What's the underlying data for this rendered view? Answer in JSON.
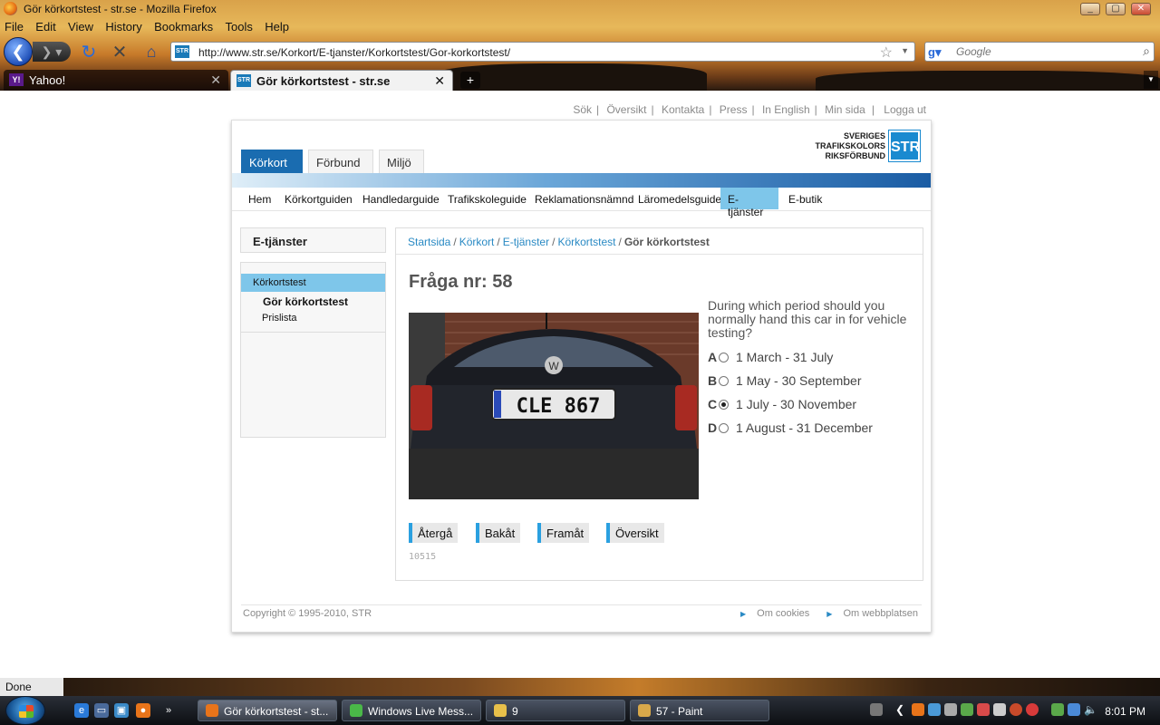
{
  "window": {
    "title": "Gör körkortstest - str.se - Mozilla Firefox"
  },
  "menu": [
    "File",
    "Edit",
    "View",
    "History",
    "Bookmarks",
    "Tools",
    "Help"
  ],
  "toolbar": {
    "url": "http://www.str.se/Korkort/E-tjanster/Korkortstest/Gor-korkortstest/",
    "search_placeholder": "Google"
  },
  "tabs": [
    {
      "label": "Yahoo!",
      "active": false
    },
    {
      "label": "Gör körkortstest - str.se",
      "active": true
    }
  ],
  "site": {
    "topnav": [
      "Sök",
      "Översikt",
      "Kontakta",
      "Press",
      "In English",
      "Min sida",
      "Logga ut"
    ],
    "logo": {
      "line1": "SVERIGES",
      "line2": "TRAFIKSKOLORS",
      "line3": "RIKSFÖRBUND",
      "mark": "STR"
    },
    "maintabs": [
      "Körkort",
      "Förbund",
      "Miljö"
    ],
    "subnav": [
      "Hem",
      "Körkortguiden",
      "Handledarguide",
      "Trafikskoleguide",
      "Reklamationsnämnd",
      "Läromedelsguide",
      "E-tjänster",
      "E-butik"
    ],
    "subnav_active": "E-tjänster",
    "sidebar": {
      "title": "E-tjänster",
      "items": [
        "Körkortstest",
        "Gör körkortstest",
        "Prislista"
      ]
    },
    "breadcrumb": [
      "Startsida",
      "Körkort",
      "E-tjänster",
      "Körkortstest"
    ],
    "breadcrumb_current": "Gör körkortstest",
    "question": {
      "title": "Fråga nr: 58",
      "text": "During which period should you normally hand this car in for vehicle testing?",
      "plate": "CLE 867",
      "answers": [
        {
          "letter": "A",
          "text": "1 March - 31 July",
          "selected": false
        },
        {
          "letter": "B",
          "text": "1 May - 30 September",
          "selected": false
        },
        {
          "letter": "C",
          "text": "1 July - 30 November",
          "selected": true
        },
        {
          "letter": "D",
          "text": "1 August - 31 December",
          "selected": false
        }
      ],
      "buttons": [
        "Återgå",
        "Bakåt",
        "Framåt",
        "Översikt"
      ],
      "id": "10515"
    },
    "footer": {
      "copyright": "Copyright © 1995-2010, STR",
      "links": [
        "Om cookies",
        "Om webbplatsen"
      ]
    }
  },
  "status": "Done",
  "taskbar": {
    "tasks": [
      "Gör körkortstest - st...",
      "Windows Live Mess...",
      "9",
      "57 - Paint"
    ],
    "clock": "8:01 PM"
  }
}
